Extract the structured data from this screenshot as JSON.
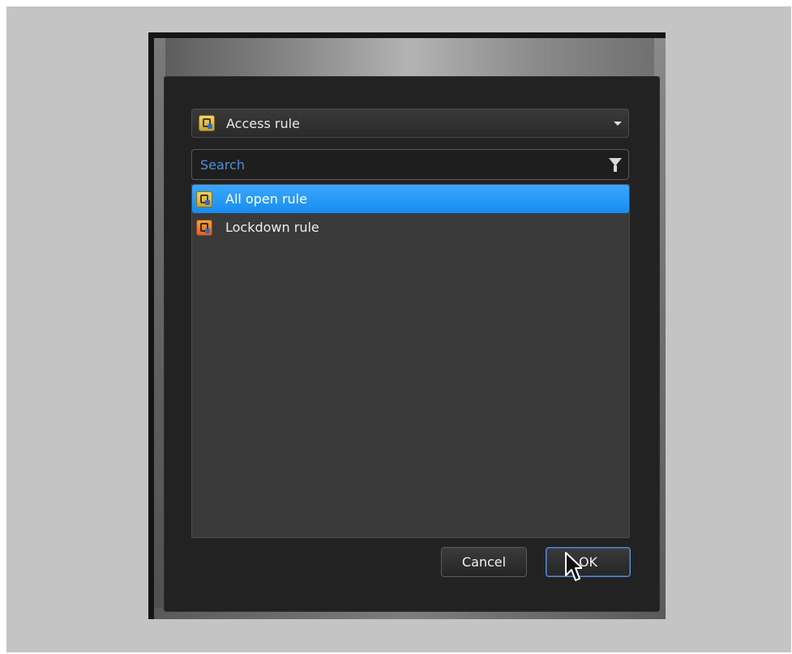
{
  "dialog": {
    "rule_type": {
      "selected": "Access rule"
    },
    "search": {
      "placeholder": "Search",
      "value": ""
    },
    "rules": [
      {
        "label": "All open rule",
        "icon": "open-rule-icon",
        "selected": true
      },
      {
        "label": "Lockdown rule",
        "icon": "lockdown-rule-icon",
        "selected": false
      }
    ],
    "buttons": {
      "cancel": "Cancel",
      "ok": "OK"
    }
  },
  "colors": {
    "selection": "#1e96f7",
    "search_placeholder": "#4f8fd6",
    "panel_background": "#222222",
    "list_background": "#3a3a3a",
    "page_background": "#c4c4c4"
  }
}
